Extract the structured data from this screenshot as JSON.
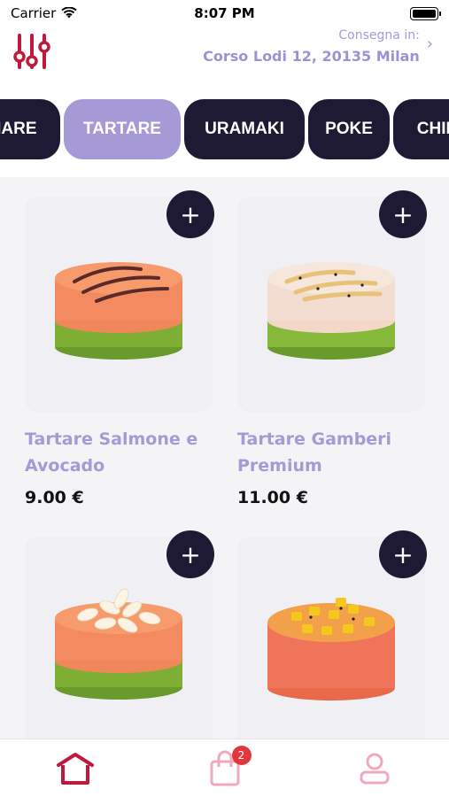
{
  "status_bar": {
    "carrier": "Carrier",
    "time": "8:07 PM"
  },
  "header": {
    "delivery_label": "Consegna in:",
    "delivery_address": "Corso Lodi 12, 20135 Milan"
  },
  "tabs": [
    {
      "label": "ZIARE",
      "active": false
    },
    {
      "label": "TARTARE",
      "active": true
    },
    {
      "label": "URAMAKI",
      "active": false
    },
    {
      "label": "POKE",
      "active": false
    },
    {
      "label": "CHIR",
      "active": false
    }
  ],
  "products": [
    {
      "name": "Tartare Salmone e Avocado",
      "price": "9.00 €"
    },
    {
      "name": "Tartare Gamberi Premium",
      "price": "11.00 €"
    },
    {
      "name": "",
      "price": ""
    },
    {
      "name": "",
      "price": ""
    }
  ],
  "cart": {
    "badge_count": "2"
  },
  "colors": {
    "accent": "#a59ad6",
    "dark": "#1f1a33",
    "brand_red": "#c1193b",
    "badge": "#e0393c"
  }
}
